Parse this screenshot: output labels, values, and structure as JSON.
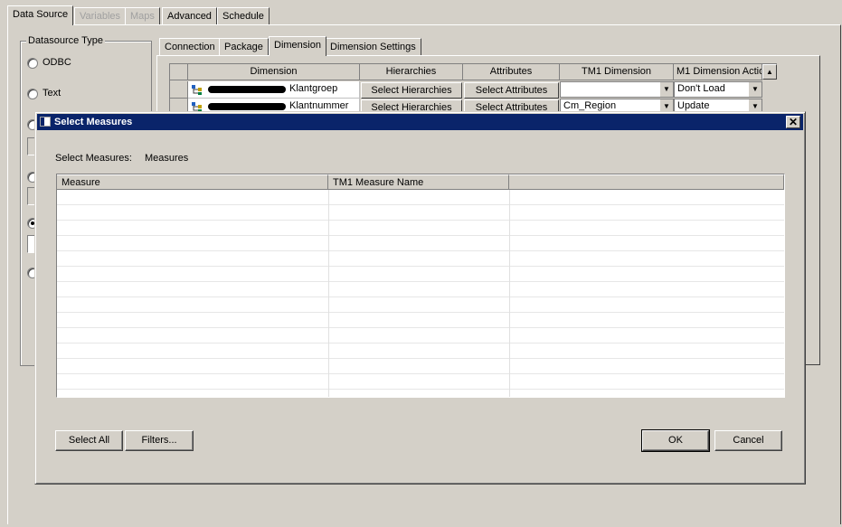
{
  "main_tabs": [
    "Data Source",
    "Variables",
    "Maps",
    "Advanced",
    "Schedule"
  ],
  "datasource_type": {
    "label": "Datasource Type",
    "options": [
      "ODBC",
      "Text"
    ]
  },
  "sub_tabs": [
    "Connection",
    "Package",
    "Dimension",
    "Dimension Settings"
  ],
  "dimension_grid": {
    "headers": [
      "Dimension",
      "Hierarchies",
      "Attributes",
      "TM1 Dimension",
      "M1 Dimension Actio"
    ],
    "rows": [
      {
        "dimension": "Klantgroep",
        "hierarchies": "Select Hierarchies",
        "attributes": "Select Attributes",
        "tm1_dimension": "",
        "action": "Don't Load"
      },
      {
        "dimension": "Klantnummer",
        "hierarchies": "Select Hierarchies",
        "attributes": "Select Attributes",
        "tm1_dimension": "Cm_Region",
        "action": "Update"
      }
    ]
  },
  "dialog": {
    "title": "Select Measures",
    "select_label": "Select Measures:",
    "select_value": "Measures",
    "columns": [
      "Measure",
      "TM1 Measure Name",
      ""
    ],
    "select_all": "Select All",
    "filters": "Filters...",
    "ok": "OK",
    "cancel": "Cancel"
  },
  "icons": {
    "close": "close-icon",
    "app": "window-app-icon",
    "dimension": "dimension-tree-icon",
    "scroll_up": "scroll-up-arrow-icon",
    "dropdown": "chevron-down-icon"
  },
  "colors": {
    "face": "#d4d0c8",
    "titlebar": "#0a246a",
    "window": "#ffffff"
  }
}
